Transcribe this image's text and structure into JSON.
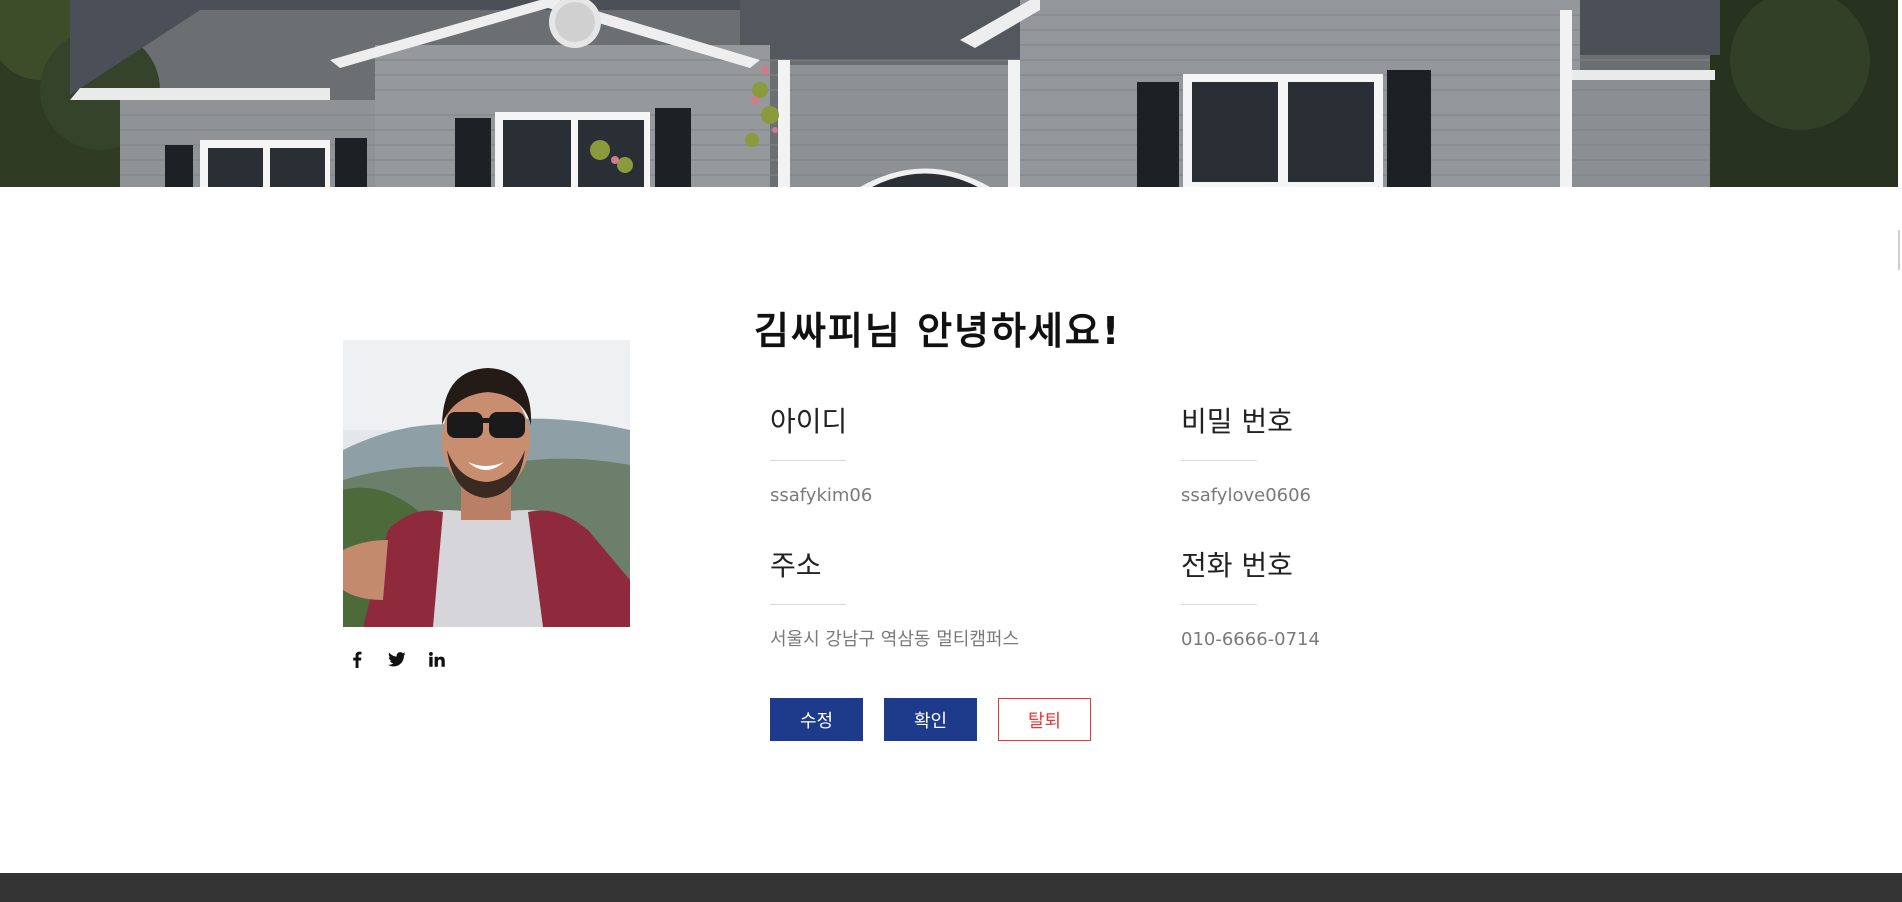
{
  "greeting": "김싸피님 안녕하세요!",
  "profile": {
    "fields": [
      {
        "label": "아이디",
        "value": "ssafykim06"
      },
      {
        "label": "비밀 번호",
        "value": "ssafylove0606"
      },
      {
        "label": "주소",
        "value": "서울시 강남구 역삼동 멀티캠퍼스"
      },
      {
        "label": "전화 번호",
        "value": "010-6666-0714"
      }
    ]
  },
  "social": [
    "facebook-icon",
    "twitter-icon",
    "linkedin-icon"
  ],
  "buttons": {
    "edit": "수정",
    "confirm": "확인",
    "withdraw": "탈퇴"
  },
  "colors": {
    "primary": "#1e3a8a",
    "danger": "#e53935",
    "footer": "#333333"
  }
}
